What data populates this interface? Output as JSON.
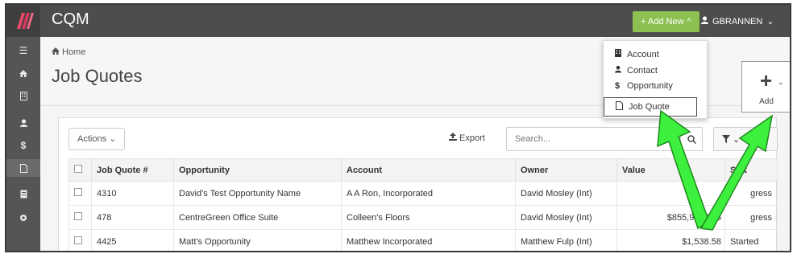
{
  "app": {
    "title": "CQM"
  },
  "topbar": {
    "add_new_label": "+ Add New",
    "user_name": "GBRANNEN"
  },
  "colors": {
    "accent": "#8cc152",
    "topbar": "#4d4d4d",
    "arrow": "#3ef03e"
  },
  "siderail": {
    "icons": [
      "menu-icon",
      "home-icon",
      "building-icon",
      "user-icon",
      "dollar-icon",
      "file-icon",
      "report-icon",
      "settings-icon"
    ]
  },
  "breadcrumb": {
    "home": "Home"
  },
  "page": {
    "title": "Job Quotes"
  },
  "add_box": {
    "label": "Add"
  },
  "dropdown": {
    "items": [
      {
        "label": "Account",
        "icon": "building-icon"
      },
      {
        "label": "Contact",
        "icon": "user-icon"
      },
      {
        "label": "Opportunity",
        "icon": "dollar-icon"
      },
      {
        "label": "Job Quote",
        "icon": "file-icon"
      }
    ]
  },
  "toolbar": {
    "actions_label": "Actions",
    "export_label": "Export",
    "search_placeholder": "Search..."
  },
  "table": {
    "columns": [
      "Job Quote #",
      "Opportunity",
      "Account",
      "Owner",
      "Value",
      "Stat"
    ],
    "rows": [
      {
        "id": "4310",
        "opportunity": "David's Test Opportunity Name",
        "account": "A A Ron, Incorporated",
        "owner": "David Mosley (Int)",
        "value": "",
        "status": "gress"
      },
      {
        "id": "478",
        "opportunity": "CentreGreen Office Suite",
        "account": "Colleen's Floors",
        "owner": "David Mosley (Int)",
        "value": "$855,973,736",
        "status": "gress"
      },
      {
        "id": "4425",
        "opportunity": "Matt's Opportunity",
        "account": "Matthew Incorporated",
        "owner": "Matthew Fulp (Int)",
        "value": "$1,538.58",
        "status": "Started"
      }
    ]
  }
}
